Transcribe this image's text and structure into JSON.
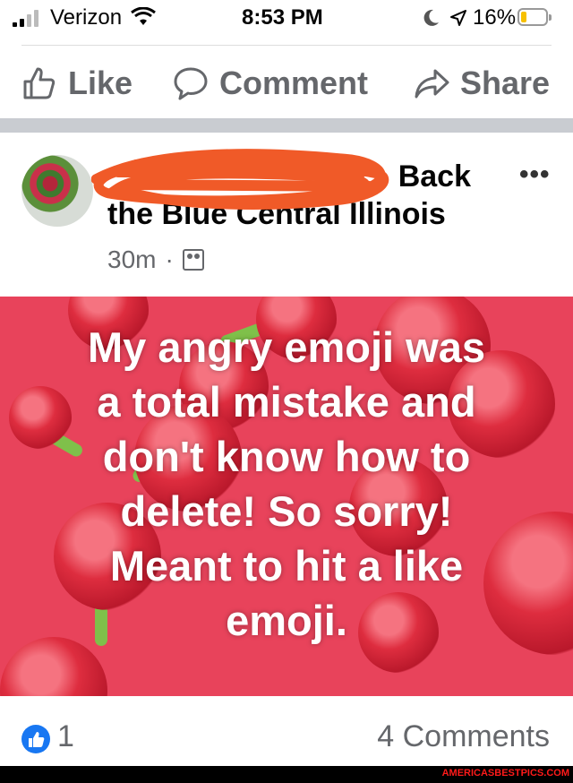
{
  "status_bar": {
    "carrier": "Verizon",
    "time": "8:53 PM",
    "battery": "16%"
  },
  "actions": {
    "like": "Like",
    "comment": "Comment",
    "share": "Share"
  },
  "post": {
    "author_line1": "Back",
    "author_line2": "the Blue Central Illinois",
    "more": "•••",
    "time": "30m",
    "dot": "·",
    "image_text": "My angry emoji was\na total mistake and\ndon't know how to\ndelete!  So sorry!\nMeant to hit a like\nemoji."
  },
  "footer": {
    "like_count": "1",
    "comments": "4 Comments"
  },
  "watermark": "AMERICASBESTPICS.COM",
  "colors": {
    "accent": "#1877f2",
    "image_bg": "#e8435b",
    "scribble": "#f05a28"
  }
}
